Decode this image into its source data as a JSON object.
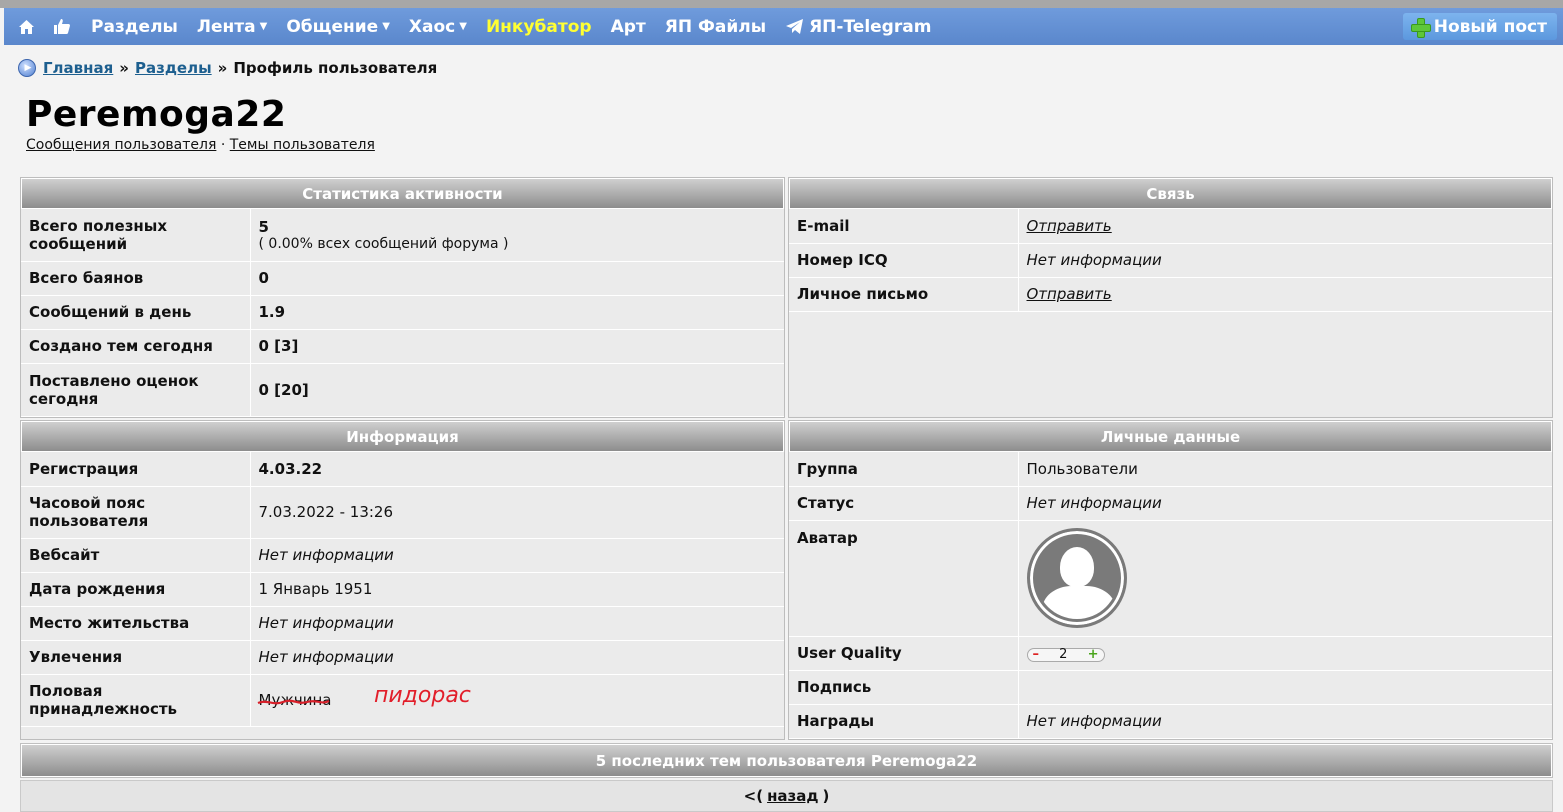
{
  "nav": {
    "items": [
      {
        "label": "Разделы",
        "caret": false
      },
      {
        "label": "Лента",
        "caret": true
      },
      {
        "label": "Общение",
        "caret": true
      },
      {
        "label": "Хаос",
        "caret": true
      },
      {
        "label": "Инкубатор",
        "caret": false,
        "highlight": "#ffff33"
      },
      {
        "label": "Арт",
        "caret": false
      },
      {
        "label": "ЯП Файлы",
        "caret": false
      },
      {
        "label": "ЯП-Telegram",
        "caret": false
      }
    ],
    "new_post": "Новый пост"
  },
  "breadcrumb": {
    "home": "Главная",
    "sections": "Разделы",
    "current": "Профиль пользователя",
    "sep": "»"
  },
  "profile": {
    "username": "Peremoga22",
    "messages_link": "Сообщения пользователя",
    "topics_link": "Темы пользователя",
    "links_sep": "·"
  },
  "activity": {
    "title": "Статистика активности",
    "rows": [
      {
        "k": "Всего полезных сообщений",
        "v": "5",
        "sub": "( 0.00% всех сообщений форума )"
      },
      {
        "k": "Всего баянов",
        "v": "0"
      },
      {
        "k": "Сообщений в день",
        "v": "1.9"
      },
      {
        "k": "Создано тем сегодня",
        "v": "0 [3]"
      },
      {
        "k": "Поставлено оценок сегодня",
        "v": "0 [20]"
      }
    ]
  },
  "contact": {
    "title": "Связь",
    "rows": [
      {
        "k": "E-mail",
        "v": "Отправить"
      },
      {
        "k": "Номер ICQ",
        "v": "Нет информации"
      },
      {
        "k": "Личное письмо",
        "v": "Отправить"
      }
    ]
  },
  "info": {
    "title": "Информация",
    "rows": [
      {
        "k": "Регистрация",
        "v": "4.03.22"
      },
      {
        "k": "Часовой пояс пользователя",
        "v": "7.03.2022 - 13:26"
      },
      {
        "k": "Вебсайт",
        "v": "Нет информации"
      },
      {
        "k": "Дата рождения",
        "v": "1 Январь 1951"
      },
      {
        "k": "Место жительства",
        "v": "Нет информации"
      },
      {
        "k": "Увлечения",
        "v": "Нет информации"
      },
      {
        "k": "Половая принадлежность",
        "v": "Мужчина"
      }
    ],
    "note": "пидорас"
  },
  "personal": {
    "title": "Личные данные",
    "rows": [
      {
        "k": "Группа",
        "v": "Пользователи"
      },
      {
        "k": "Статус",
        "v": "Нет информации"
      },
      {
        "k": "Аватар",
        "v": ""
      },
      {
        "k": "User Quality",
        "v": "2"
      },
      {
        "k": "Подпись",
        "v": ""
      },
      {
        "k": "Награды",
        "v": "Нет информации"
      }
    ],
    "uq_minus": "–",
    "uq_plus": "+"
  },
  "recent": {
    "title": "5 последних тем пользователя Peremoga22"
  },
  "back": {
    "prefix": "<(",
    "label": "назад",
    "suffix": ")"
  },
  "colors": {
    "nav_bg": "#6f9bdc",
    "highlight": "#ffff33",
    "note": "#e21e2a"
  }
}
